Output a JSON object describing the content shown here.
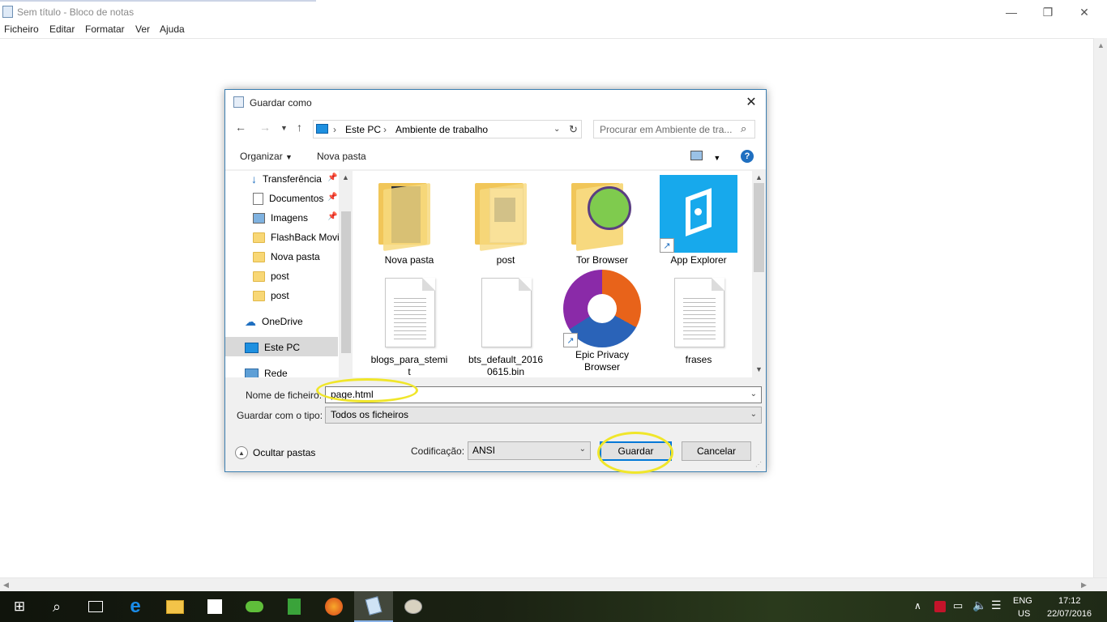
{
  "notepad": {
    "title": "Sem título - Bloco de notas",
    "menu": [
      "Ficheiro",
      "Editar",
      "Formatar",
      "Ver",
      "Ajuda"
    ],
    "controls": {
      "minimize": "—",
      "restore": "❐",
      "close": "✕"
    }
  },
  "dialog": {
    "title": "Guardar como",
    "breadcrumb": [
      "Este PC",
      "Ambiente de trabalho"
    ],
    "search_placeholder": "Procurar em Ambiente de tra...",
    "toolbar": {
      "organize": "Organizar",
      "new_folder": "Nova pasta"
    },
    "nav_items": [
      {
        "label": "Transferência",
        "icon": "download-arrow-icon",
        "pinned": true
      },
      {
        "label": "Documentos",
        "icon": "documents-icon",
        "pinned": true
      },
      {
        "label": "Imagens",
        "icon": "pictures-icon",
        "pinned": true
      },
      {
        "label": "FlashBack Movies",
        "icon": "folder-icon",
        "pinned": false
      },
      {
        "label": "Nova pasta",
        "icon": "folder-icon",
        "pinned": false
      },
      {
        "label": "post",
        "icon": "folder-icon",
        "pinned": false
      },
      {
        "label": "post",
        "icon": "folder-icon",
        "pinned": false
      },
      {
        "label": "OneDrive",
        "icon": "onedrive-cloud-icon",
        "pinned": false
      },
      {
        "label": "Este PC",
        "icon": "computer-icon",
        "pinned": false,
        "selected": true
      },
      {
        "label": "Rede",
        "icon": "network-icon",
        "pinned": false
      }
    ],
    "files": [
      {
        "name": "Nova pasta",
        "type": "folder"
      },
      {
        "name": "post",
        "type": "folder"
      },
      {
        "name": "Tor Browser",
        "type": "folder"
      },
      {
        "name": "App Explorer",
        "type": "shortcut"
      },
      {
        "name": "blogs_para_stemit",
        "type": "text-file"
      },
      {
        "name": "bts_default_20160615.bin",
        "type": "file"
      },
      {
        "name": "Epic Privacy Browser",
        "type": "shortcut"
      },
      {
        "name": "frases",
        "type": "text-file"
      }
    ],
    "filename_label": "Nome de ficheiro:",
    "filename_value": "page.html",
    "filetype_label": "Guardar com o tipo:",
    "filetype_value": "Todos os ficheiros",
    "encoding_label": "Codificação:",
    "encoding_value": "ANSI",
    "save": "Guardar",
    "cancel": "Cancelar",
    "hide_folders": "Ocultar pastas"
  },
  "taskbar": {
    "lang": "ENG",
    "layout": "US",
    "time": "17:12",
    "date": "22/07/2016"
  },
  "colors": {
    "accent": "#0078d7",
    "highlight_ring": "#f0e62a",
    "folder": "#f7d97f"
  }
}
